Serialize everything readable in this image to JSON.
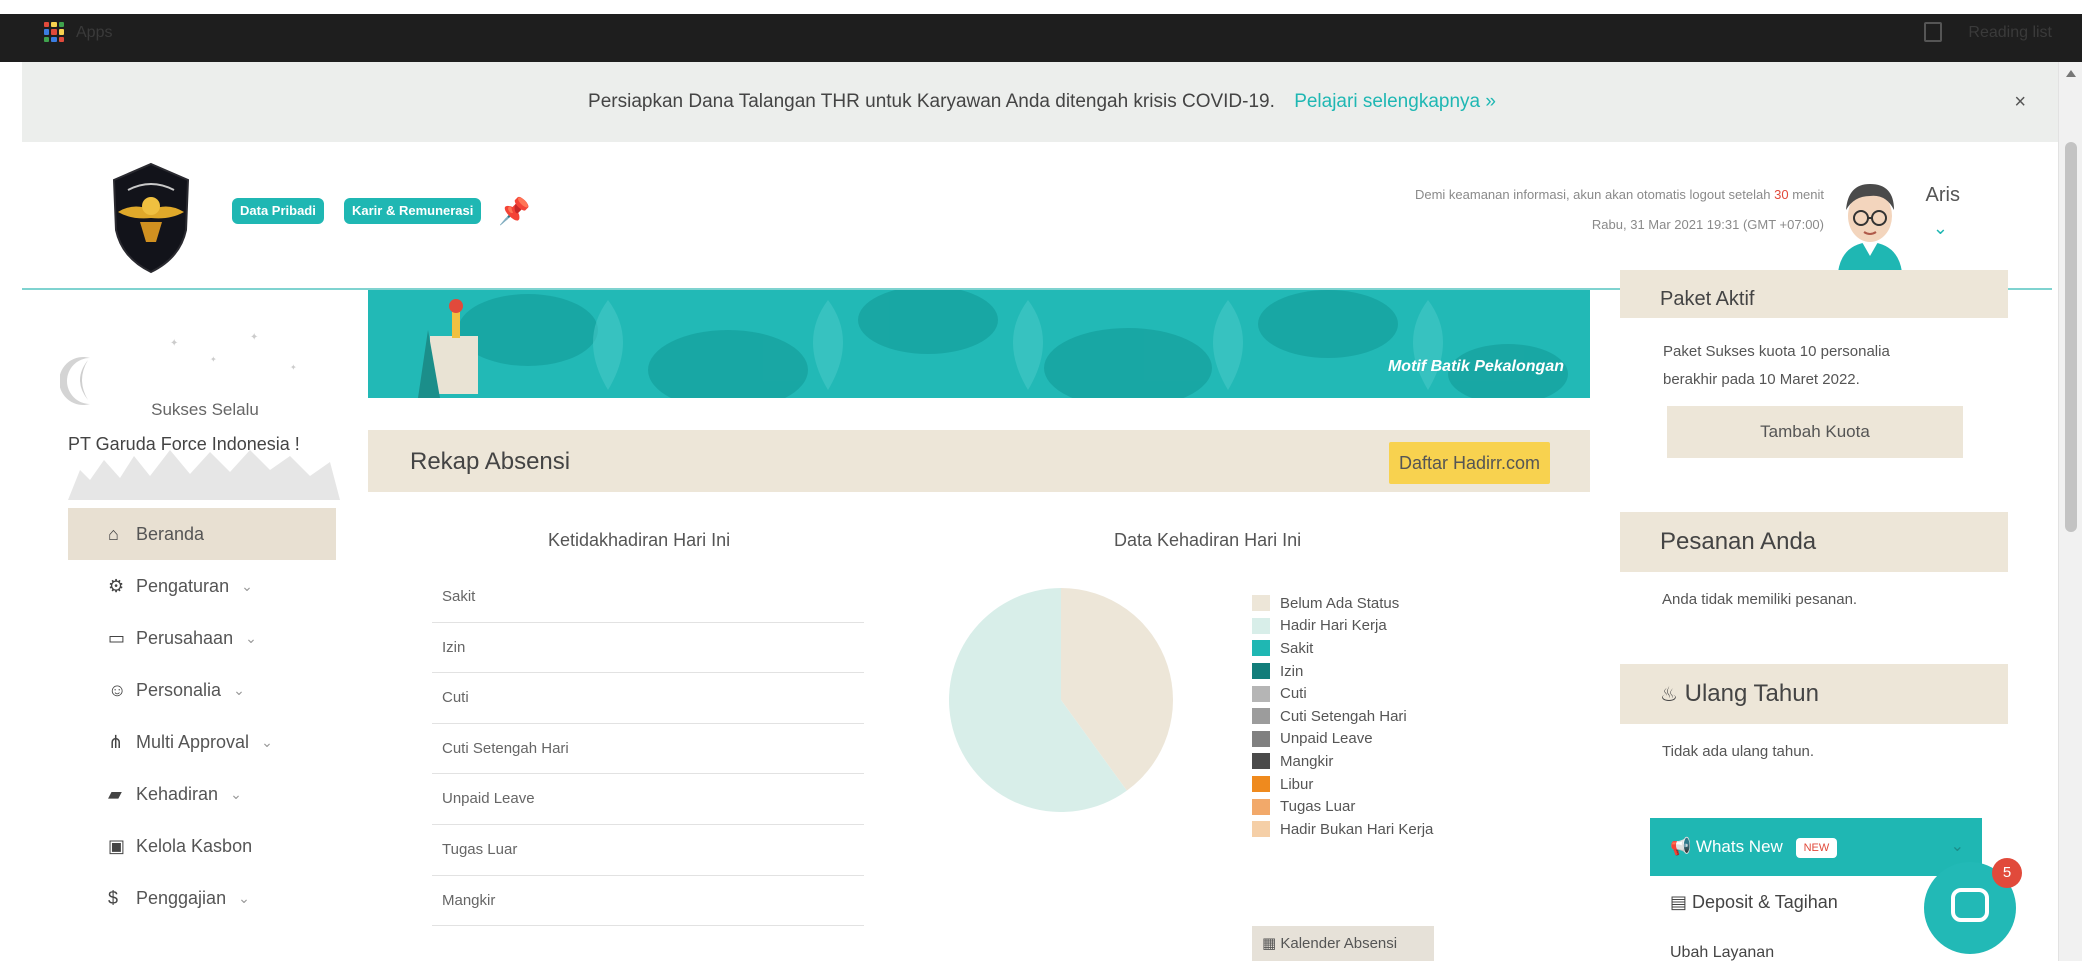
{
  "browser": {
    "apps_label": "Apps",
    "reading_list": "Reading list"
  },
  "announcement": {
    "text": "Persiapkan Dana Talangan THR untuk Karyawan Anda ditengah krisis COVID-19.",
    "link": "Pelajari selengkapnya »",
    "close": "×"
  },
  "header": {
    "tags": [
      "Data Pribadi",
      "Karir & Remunerasi"
    ],
    "security_note_pre": "Demi keamanan informasi, akun akan otomatis logout setelah",
    "security_minutes": "30",
    "security_note_post": "menit",
    "datetime": "Rabu, 31 Mar 2021 19:31 (GMT +07:00)",
    "username": "Aris"
  },
  "sidebar": {
    "greeting": "Sukses Selalu",
    "company": "PT Garuda Force Indonesia !",
    "items": [
      {
        "label": "Beranda",
        "icon": "home-icon",
        "glyph": "⌂",
        "expandable": false
      },
      {
        "label": "Pengaturan",
        "icon": "gears-icon",
        "glyph": "⚙",
        "expandable": true
      },
      {
        "label": "Perusahaan",
        "icon": "folder-icon",
        "glyph": "▭",
        "expandable": true
      },
      {
        "label": "Personalia",
        "icon": "smiley-icon",
        "glyph": "☺",
        "expandable": true
      },
      {
        "label": "Multi Approval",
        "icon": "sitemap-icon",
        "glyph": "⋔",
        "expandable": true
      },
      {
        "label": "Kehadiran",
        "icon": "book-icon",
        "glyph": "▰",
        "expandable": true
      },
      {
        "label": "Kelola Kasbon",
        "icon": "id-card-icon",
        "glyph": "▣",
        "expandable": false
      },
      {
        "label": "Penggajian",
        "icon": "dollar-icon",
        "glyph": "$",
        "expandable": true
      }
    ]
  },
  "banner": {
    "caption": "Motif Batik Pekalongan"
  },
  "rekap": {
    "title": "Rekap Absensi",
    "daftar_button": "Daftar Hadirr.com",
    "absent_title": "Ketidakhadiran Hari Ini",
    "absent_rows": [
      "Sakit",
      "Izin",
      "Cuti",
      "Cuti Setengah Hari",
      "Unpaid Leave",
      "Tugas Luar",
      "Mangkir"
    ],
    "chart_title": "Data Kehadiran Hari Ini",
    "kalender_button": "Kalender Absensi"
  },
  "chart_data": {
    "type": "pie",
    "title": "Data Kehadiran Hari Ini",
    "categories": [
      "Belum Ada Status",
      "Hadir Hari Kerja",
      "Sakit",
      "Izin",
      "Cuti",
      "Cuti Setengah Hari",
      "Unpaid Leave",
      "Mangkir",
      "Libur",
      "Tugas Luar",
      "Hadir Bukan Hari Kerja"
    ],
    "values": [
      40,
      60,
      0,
      0,
      0,
      0,
      0,
      0,
      0,
      0,
      0
    ],
    "colors": [
      "#ede6d8",
      "#d8eee9",
      "#1fb7b3",
      "#127d7a",
      "#b5b5b5",
      "#9c9c9c",
      "#808080",
      "#4a4a4a",
      "#ef8a1e",
      "#f2a96a",
      "#f5cfa7"
    ],
    "legend_position": "right"
  },
  "right": {
    "paket_head": "Paket Aktif",
    "paket_text_1": "Paket Sukses kuota 10 personalia",
    "paket_text_2": "berakhir pada 10 Maret 2022.",
    "tambah_button": "Tambah Kuota",
    "pesanan_head": "Pesanan Anda",
    "pesanan_text": "Anda tidak memiliki pesanan.",
    "ultah_head": "Ulang Tahun",
    "ultah_text": "Tidak ada ulang tahun.",
    "whatsnew": "Whats New",
    "new_badge": "NEW",
    "deposit": "Deposit & Tagihan",
    "ubah": "Ubah Layanan"
  },
  "chat": {
    "count": "5"
  }
}
